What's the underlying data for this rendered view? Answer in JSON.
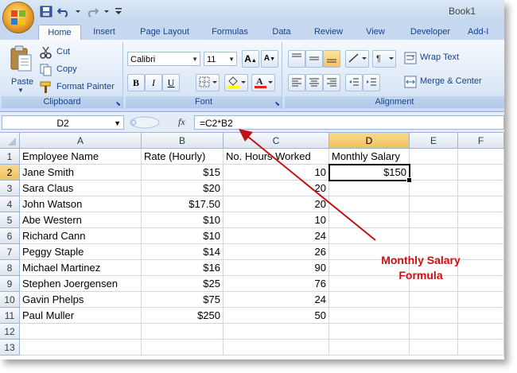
{
  "window": {
    "title": "Book1"
  },
  "ribbon_tabs": [
    "Home",
    "Insert",
    "Page Layout",
    "Formulas",
    "Data",
    "Review",
    "View",
    "Developer",
    "Add-I"
  ],
  "clipboard": {
    "paste": "Paste",
    "cut": "Cut",
    "copy": "Copy",
    "format_painter": "Format Painter",
    "label": "Clipboard"
  },
  "font": {
    "name": "Calibri",
    "size": "11",
    "bold": "B",
    "italic": "I",
    "underline": "U",
    "grow": "A",
    "shrink": "A",
    "label": "Font"
  },
  "alignment": {
    "wrap_text": "Wrap Text",
    "merge_center": "Merge & Center",
    "label": "Alignment"
  },
  "formula_bar": {
    "name_box": "D2",
    "fx": "fx",
    "formula": "=C2*B2"
  },
  "columns": [
    "A",
    "B",
    "C",
    "D",
    "E",
    "F"
  ],
  "rows": [
    "1",
    "2",
    "3",
    "4",
    "5",
    "6",
    "7",
    "8",
    "9",
    "10",
    "11",
    "12",
    "13"
  ],
  "headers": [
    "Employee Name",
    "Rate (Hourly)",
    "No. Hours Worked",
    "Monthly Salary"
  ],
  "data": [
    {
      "name": "Jane Smith",
      "rate": "$15",
      "hours": "10",
      "salary": "$150"
    },
    {
      "name": "Sara Claus",
      "rate": "$20",
      "hours": "20",
      "salary": ""
    },
    {
      "name": "John Watson",
      "rate": "$17.50",
      "hours": "20",
      "salary": ""
    },
    {
      "name": "Abe Western",
      "rate": "$10",
      "hours": "10",
      "salary": ""
    },
    {
      "name": "Richard Cann",
      "rate": "$10",
      "hours": "24",
      "salary": ""
    },
    {
      "name": "Peggy Staple",
      "rate": "$14",
      "hours": "26",
      "salary": ""
    },
    {
      "name": "Michael Martinez",
      "rate": "$16",
      "hours": "90",
      "salary": ""
    },
    {
      "name": "Stephen Joergensen",
      "rate": "$25",
      "hours": "76",
      "salary": ""
    },
    {
      "name": "Gavin Phelps",
      "rate": "$75",
      "hours": "24",
      "salary": ""
    },
    {
      "name": "Paul Muller",
      "rate": "$250",
      "hours": "50",
      "salary": ""
    }
  ],
  "annotation": {
    "line1": "Monthly Salary",
    "line2": "Formula",
    "color": "#d01010"
  }
}
